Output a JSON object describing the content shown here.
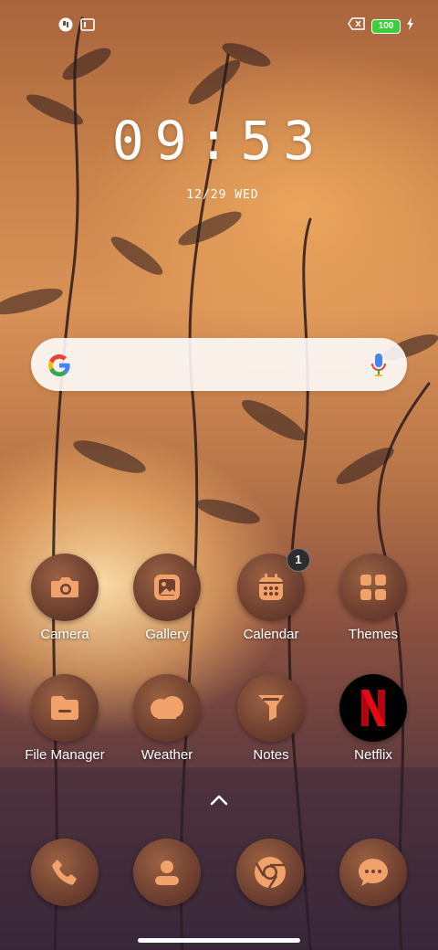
{
  "status_bar": {
    "left_icons": [
      "app-notification-icon",
      "screen-icon"
    ],
    "battery_level": "100",
    "right_icons": [
      "no-sim-icon",
      "battery-icon",
      "charging-icon"
    ]
  },
  "clock": {
    "time": "09:53",
    "date": "12/29 WED"
  },
  "search": {
    "icons": [
      "google-logo-icon",
      "microphone-icon"
    ]
  },
  "apps": [
    {
      "label": "Camera",
      "icon": "camera-icon"
    },
    {
      "label": "Gallery",
      "icon": "gallery-icon"
    },
    {
      "label": "Calendar",
      "icon": "calendar-icon",
      "badge": "1"
    },
    {
      "label": "Themes",
      "icon": "themes-icon"
    },
    {
      "label": "File Manager",
      "icon": "folder-icon"
    },
    {
      "label": "Weather",
      "icon": "cloud-icon"
    },
    {
      "label": "Notes",
      "icon": "notes-icon"
    },
    {
      "label": "Netflix",
      "icon": "netflix-logo-icon"
    }
  ],
  "dock": [
    {
      "icon": "phone-icon"
    },
    {
      "icon": "contacts-icon"
    },
    {
      "icon": "chrome-icon"
    },
    {
      "icon": "messages-icon"
    }
  ],
  "colors": {
    "icon_bg": "#6e4030",
    "icon_glyph": "#f0a26a",
    "battery_fill": "#3ccf3c",
    "netflix_red": "#e50914",
    "badge_bg": "#2d2d2d"
  }
}
